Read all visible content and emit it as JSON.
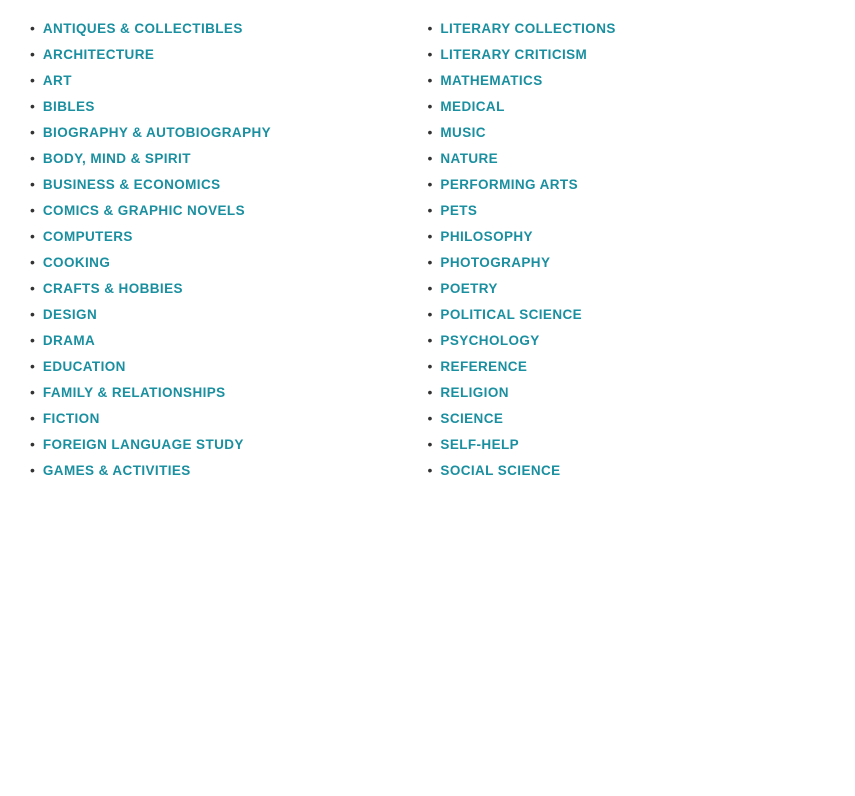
{
  "columns": {
    "left": {
      "items": [
        "ANTIQUES & COLLECTIBLES",
        "ARCHITECTURE",
        "ART",
        "BIBLES",
        "BIOGRAPHY & AUTOBIOGRAPHY",
        "BODY, MIND & SPIRIT",
        "BUSINESS & ECONOMICS",
        "COMICS & GRAPHIC NOVELS",
        "COMPUTERS",
        "COOKING",
        "CRAFTS & HOBBIES",
        "DESIGN",
        "DRAMA",
        "EDUCATION",
        "FAMILY & RELATIONSHIPS",
        "FICTION",
        "FOREIGN LANGUAGE STUDY",
        "GAMES & ACTIVITIES"
      ]
    },
    "right": {
      "items": [
        "LITERARY COLLECTIONS",
        "LITERARY CRITICISM",
        "MATHEMATICS",
        "MEDICAL",
        "MUSIC",
        "NATURE",
        "PERFORMING ARTS",
        "PETS",
        "PHILOSOPHY",
        "PHOTOGRAPHY",
        "POETRY",
        "POLITICAL SCIENCE",
        "PSYCHOLOGY",
        "REFERENCE",
        "RELIGION",
        "SCIENCE",
        "SELF-HELP",
        "SOCIAL SCIENCE"
      ]
    }
  }
}
